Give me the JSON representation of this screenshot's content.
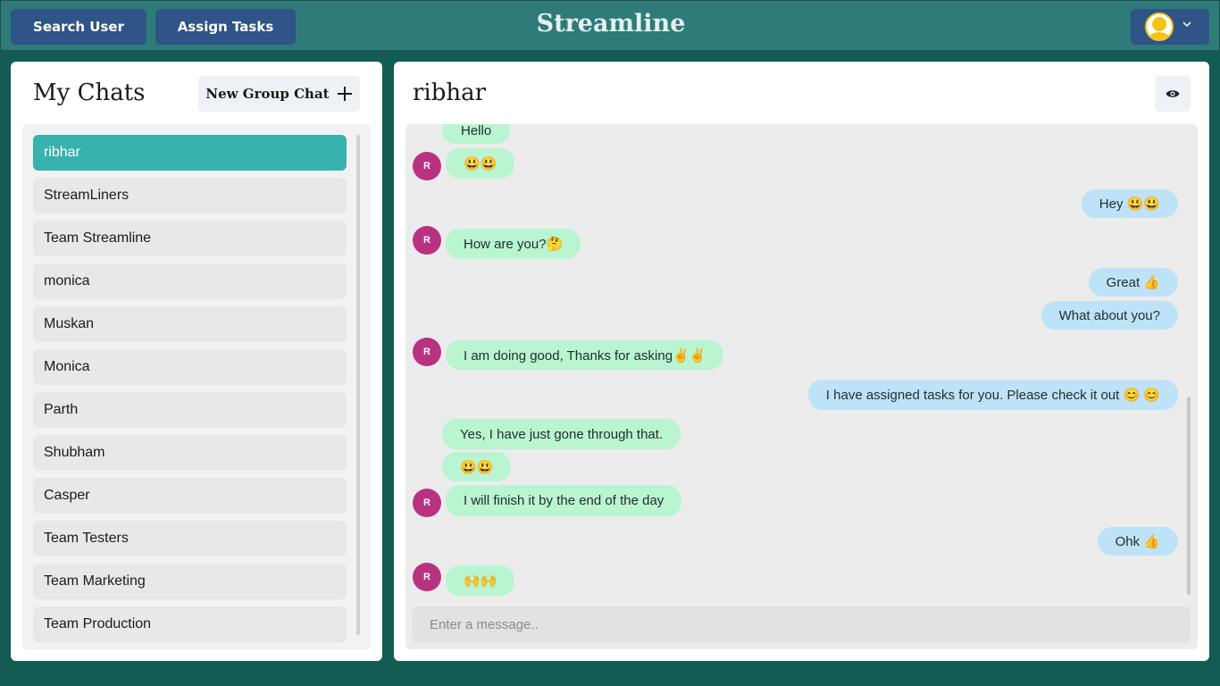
{
  "header": {
    "search_label": "Search User",
    "assign_label": "Assign Tasks",
    "brand": "Streamline",
    "colors": {
      "header_bg": "#2f7b79",
      "button_bg": "#2f5487",
      "page_bg": "#125c54"
    }
  },
  "sidebar": {
    "title": "My Chats",
    "new_group_label": "New Group Chat",
    "chats": [
      {
        "name": "ribhar",
        "active": true
      },
      {
        "name": "StreamLiners"
      },
      {
        "name": "Team Streamline"
      },
      {
        "name": "monica"
      },
      {
        "name": "Muskan"
      },
      {
        "name": "Monica"
      },
      {
        "name": "Parth"
      },
      {
        "name": "Shubham"
      },
      {
        "name": "Casper"
      },
      {
        "name": "Team Testers"
      },
      {
        "name": "Team Marketing"
      },
      {
        "name": "Team Production"
      }
    ]
  },
  "conversation": {
    "title": "ribhar",
    "sender_initial": "R",
    "messages": [
      {
        "text": "Hello",
        "from": "them"
      },
      {
        "text": "😃😃",
        "from": "them"
      },
      {
        "text": "Hey 😃😃",
        "from": "me"
      },
      {
        "text": "How are you?🤔",
        "from": "them"
      },
      {
        "text": "Great 👍",
        "from": "me"
      },
      {
        "text": "What about you?",
        "from": "me"
      },
      {
        "text": "I am doing good, Thanks for asking✌✌",
        "from": "them"
      },
      {
        "text": "I have assigned tasks for you. Please check it out 😊 😊",
        "from": "me"
      },
      {
        "text": "Yes, I have just gone through that.",
        "from": "them"
      },
      {
        "text": "😃😃",
        "from": "them"
      },
      {
        "text": "I will finish it by the end of the day",
        "from": "them"
      },
      {
        "text": "Ohk 👍",
        "from": "me"
      },
      {
        "text": "🙌🙌",
        "from": "them"
      }
    ],
    "input_placeholder": "Enter a message.."
  }
}
